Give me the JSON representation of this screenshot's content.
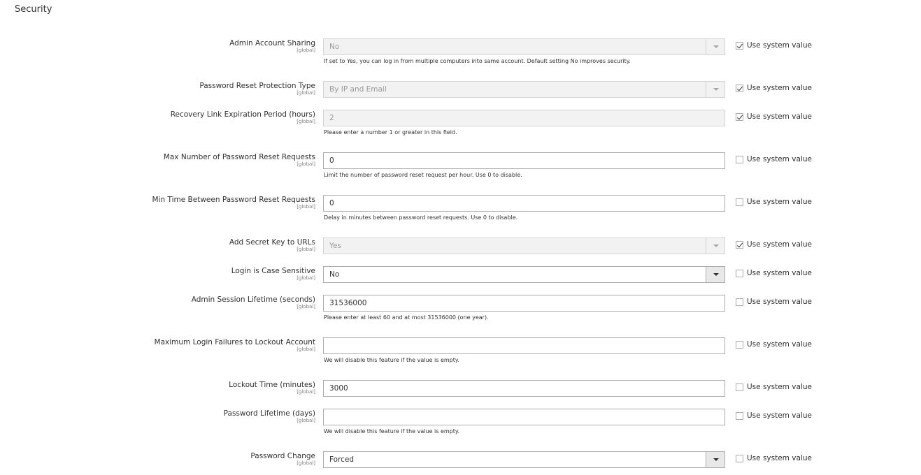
{
  "section": {
    "title": "Security"
  },
  "system_value_label": "Use system value",
  "fields": [
    {
      "label": "Admin Account Sharing",
      "scope": "[global]",
      "value": "No",
      "note": "If set to Yes, you can log in from multiple computers into same account. Default setting No improves security.",
      "use_system_value": true
    },
    {
      "label": "Password Reset Protection Type",
      "scope": "[global]",
      "value": "By IP and Email",
      "note": "",
      "use_system_value": true
    },
    {
      "label": "Recovery Link Expiration Period (hours)",
      "scope": "[global]",
      "value": "2",
      "note": "Please enter a number 1 or greater in this field.",
      "use_system_value": true
    },
    {
      "label": "Max Number of Password Reset Requests",
      "scope": "[global]",
      "value": "0",
      "note": "Limit the number of password reset request per hour. Use 0 to disable.",
      "use_system_value": false
    },
    {
      "label": "Min Time Between Password Reset Requests",
      "scope": "[global]",
      "value": "0",
      "note": "Delay in minutes between password reset requests. Use 0 to disable.",
      "use_system_value": false
    },
    {
      "label": "Add Secret Key to URLs",
      "scope": "[global]",
      "value": "Yes",
      "note": "",
      "use_system_value": true
    },
    {
      "label": "Login is Case Sensitive",
      "scope": "[global]",
      "value": "No",
      "note": "",
      "use_system_value": false
    },
    {
      "label": "Admin Session Lifetime (seconds)",
      "scope": "[global]",
      "value": "31536000",
      "note": "Please enter at least 60 and at most 31536000 (one year).",
      "use_system_value": false
    },
    {
      "label": "Maximum Login Failures to Lockout Account",
      "scope": "[global]",
      "value": "",
      "note": "We will disable this feature if the value is empty.",
      "use_system_value": false
    },
    {
      "label": "Lockout Time (minutes)",
      "scope": "[global]",
      "value": "3000",
      "note": "",
      "use_system_value": false
    },
    {
      "label": "Password Lifetime (days)",
      "scope": "[global]",
      "value": "",
      "note": "We will disable this feature if the value is empty.",
      "use_system_value": false
    },
    {
      "label": "Password Change",
      "scope": "[global]",
      "value": "Forced",
      "note": "",
      "use_system_value": false
    }
  ]
}
